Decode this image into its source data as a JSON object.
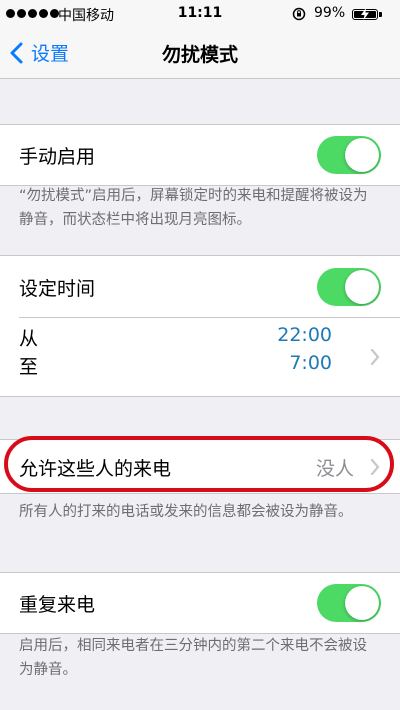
{
  "status_bar": {
    "carrier": "中国移动",
    "time": "11:11",
    "battery_percent": "99%",
    "icons": [
      "signal-dots-icon",
      "rotation-lock-icon",
      "battery-charging-icon"
    ]
  },
  "nav": {
    "back_label": "设置",
    "title": "勿扰模式"
  },
  "manual": {
    "label": "手动启用",
    "switch_on": true,
    "footer": "“勿扰模式”启用后，屏幕锁定时的来电和提醒将被设为静音，而状态栏中将出现月亮图标。"
  },
  "scheduled": {
    "label": "设定时间",
    "switch_on": true,
    "from_label": "从",
    "to_label": "至",
    "from_time": "22:00",
    "to_time": "7:00"
  },
  "allow_calls": {
    "label": "允许这些人的来电",
    "value": "没人",
    "footer": "所有人的打来的电话或发来的信息都会被设为静音。"
  },
  "repeated": {
    "label": "重复来电",
    "switch_on": true,
    "footer": "启用后，相同来电者在三分钟内的第二个来电不会被设为静音。"
  },
  "colors": {
    "accent": "#0a7aff",
    "switch_on": "#4cd964",
    "time_value": "#1e7ab4",
    "highlight": "#d70c18",
    "background": "#efeff4"
  }
}
